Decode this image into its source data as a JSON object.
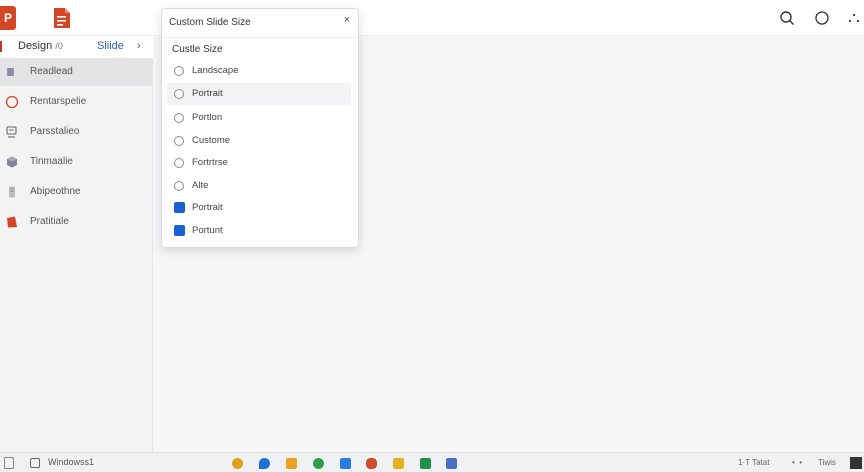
{
  "app": {
    "logo_letter": "P"
  },
  "tabs": {
    "design": "Design",
    "design_suffix": "/0",
    "slide": "Sliide",
    "arrow": "›"
  },
  "sidebar": {
    "items": [
      {
        "label": "Readlead",
        "icon": "slide-icon",
        "active": true
      },
      {
        "label": "Rentarspelie",
        "icon": "circle-icon",
        "active": false
      },
      {
        "label": "Parsstalieo",
        "icon": "monitor-icon",
        "active": false
      },
      {
        "label": "Tinmaalie",
        "icon": "cube-icon",
        "active": false
      },
      {
        "label": "Abipeothne",
        "icon": "document-icon",
        "active": false
      },
      {
        "label": "Pratitiale",
        "icon": "shape-icon",
        "active": false
      }
    ]
  },
  "dialog": {
    "title": "Custom Slide Size",
    "close": "×",
    "section": "Custle Size",
    "options": [
      {
        "label": "Landscape",
        "type": "radio"
      },
      {
        "label": "Portrait",
        "type": "radio"
      },
      {
        "label": "Portlon",
        "type": "radio"
      },
      {
        "label": "Custome",
        "type": "radio"
      },
      {
        "label": "Fortrtrse",
        "type": "radio"
      },
      {
        "label": "Alte",
        "type": "radio"
      },
      {
        "label": "Portrait",
        "type": "check"
      },
      {
        "label": "Portunt",
        "type": "check"
      }
    ]
  },
  "taskbar": {
    "search_text": "Windowss1",
    "tray_text_1": "1·T Tatat",
    "tray_text_2": "•  •",
    "tray_text_3": "Tiwis"
  },
  "colors": {
    "accent_blue": "#1a5fd6",
    "ppt_red": "#d24726"
  }
}
